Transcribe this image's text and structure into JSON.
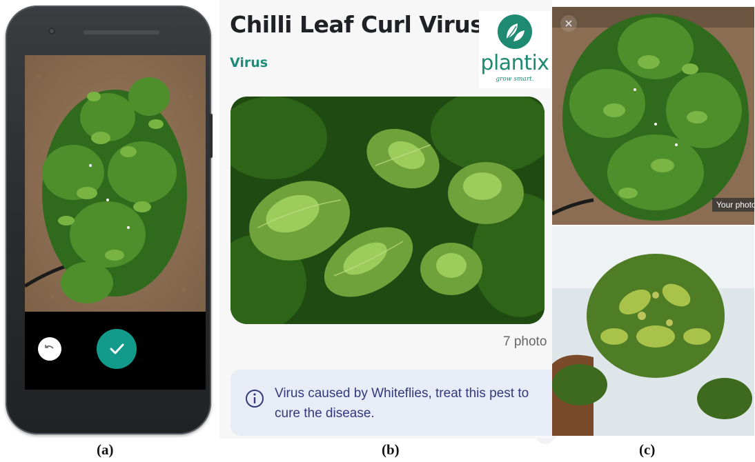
{
  "panel_b": {
    "title": "Chilli Leaf Curl Virus",
    "category": "Virus",
    "photo_count": "7 photo",
    "info_text": "Virus caused by Whiteflies, treat this pest to cure the disease."
  },
  "logo": {
    "name": "plantix",
    "tagline": "grow smart."
  },
  "panel_c": {
    "your_photo_label": "Your photo"
  },
  "captions": {
    "a": "(a)",
    "b": "(b)",
    "c": "(c)"
  },
  "colors": {
    "accent": "#129b8b",
    "category_green": "#1f8c7a",
    "info_box": "#e7ecf7",
    "info_text": "#33397a"
  },
  "icons": [
    "undo-icon",
    "check-icon",
    "info-icon",
    "tap-hand-icon",
    "close-icon",
    "plantix-leaf-logo"
  ]
}
